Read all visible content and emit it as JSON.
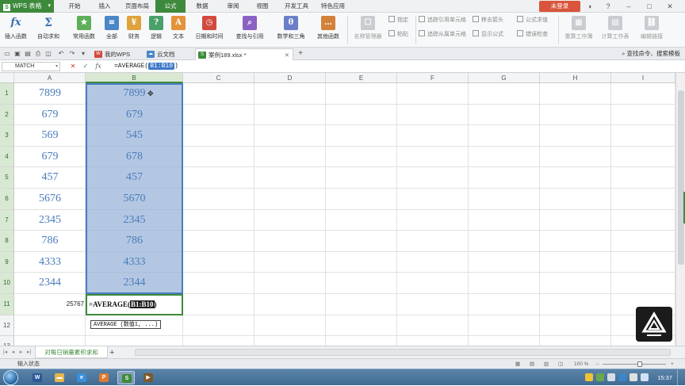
{
  "menubar": {
    "app_name": "WPS 表格",
    "tabs": [
      "开始",
      "插入",
      "页面布局",
      "公式",
      "数据",
      "审阅",
      "视图",
      "开发工具",
      "特色应用"
    ],
    "active_tab": "公式",
    "login": "未登录"
  },
  "ribbon": {
    "buttons": [
      "插入函数",
      "自动求和",
      "常用函数",
      "全部",
      "财务",
      "逻辑",
      "文本",
      "日期和时间",
      "查找与引用",
      "数学和三角",
      "其他函数"
    ],
    "group2": [
      "名称管理器",
      "粘贴"
    ],
    "small": [
      "指定",
      "追踪引用单元格",
      "移去箭头",
      "公式求值",
      "追踪从属单元格",
      "显示公式",
      "错误检查"
    ],
    "right": [
      "重算工作簿",
      "计算工作表",
      "编辑链接"
    ]
  },
  "doc_tabs": {
    "tabs": [
      "我的WPS",
      "云文档",
      "案例189.xlsx *"
    ],
    "active": "案例189.xlsx *",
    "help_search": "查找命令、搜索模板"
  },
  "formula_bar": {
    "name_box": "MATCH",
    "fx": "fx",
    "formula_prefix": "=AVERAGE(",
    "formula_ref": "B1:B10",
    "formula_suffix": ")"
  },
  "grid": {
    "columns": [
      "A",
      "B",
      "C",
      "D",
      "E",
      "F",
      "G",
      "H",
      "I"
    ],
    "rows": [
      "1",
      "2",
      "3",
      "4",
      "5",
      "6",
      "7",
      "8",
      "9",
      "10",
      "11",
      "12",
      "13"
    ],
    "col_a": [
      "7899",
      "679",
      "569",
      "679",
      "457",
      "5676",
      "2345",
      "786",
      "4333",
      "2344"
    ],
    "col_b": [
      "7899",
      "679",
      "545",
      "678",
      "457",
      "5670",
      "2345",
      "786",
      "4333",
      "2344"
    ],
    "a11": "25767",
    "b11_prefix": "=AVERAGE(",
    "b11_ref": "B1:B10",
    "b11_suffix": ")",
    "tooltip": "AVERAGE (数值1, ...)"
  },
  "sheet": {
    "tab": "对每日销量累积求和",
    "status": "输入状态",
    "zoom": "100 %"
  },
  "taskbar": {
    "clock": "15:37"
  },
  "colors": {
    "accent_green": "#3e8a3c",
    "selection_blue": "#4a7cc4",
    "cell_text_blue": "#4a7cba"
  }
}
